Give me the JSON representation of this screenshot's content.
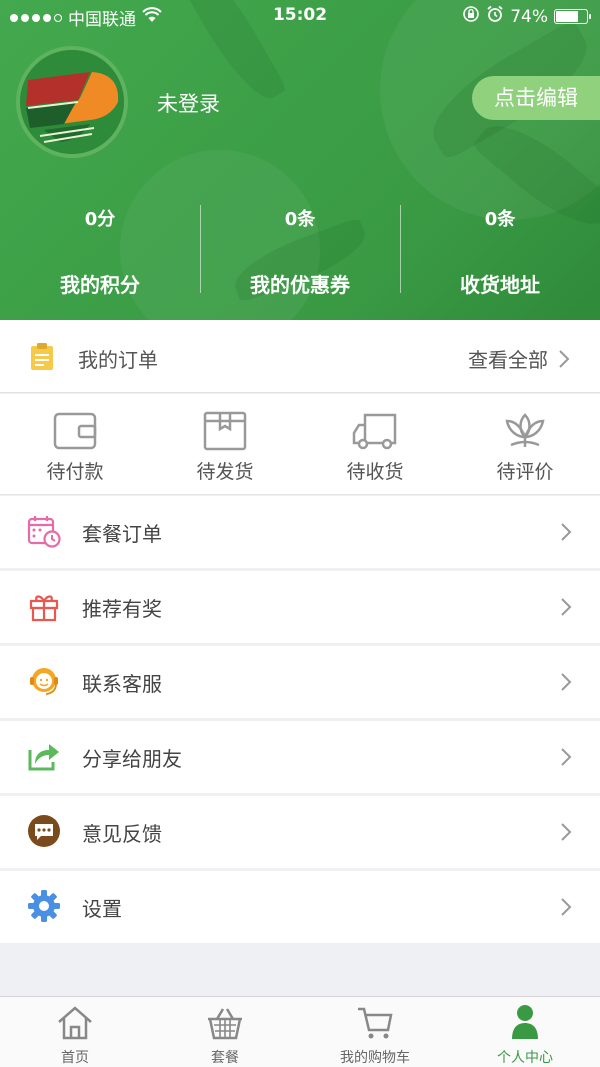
{
  "status_bar": {
    "carrier": "中国联通",
    "time": "15:02",
    "battery": "74%",
    "battery_level": 0.74
  },
  "profile": {
    "login_status": "未登录",
    "edit_label": "点击编辑"
  },
  "stats": [
    {
      "value": "0分",
      "label": "我的积分"
    },
    {
      "value": "0条",
      "label": "我的优惠券"
    },
    {
      "value": "0条",
      "label": "收货地址"
    }
  ],
  "orders": {
    "title": "我的订单",
    "view_all": "查看全部",
    "statuses": [
      {
        "label": "待付款",
        "icon": "wallet-icon"
      },
      {
        "label": "待发货",
        "icon": "package-icon"
      },
      {
        "label": "待收货",
        "icon": "truck-icon"
      },
      {
        "label": "待评价",
        "icon": "flower-icon"
      }
    ]
  },
  "menu": [
    {
      "label": "套餐订单",
      "icon": "calendar-clock-icon",
      "color": "#e86aa6"
    },
    {
      "label": "推荐有奖",
      "icon": "gift-icon",
      "color": "#e8584f"
    },
    {
      "label": "联系客服",
      "icon": "customer-service-icon",
      "color": "#f5a623"
    },
    {
      "label": "分享给朋友",
      "icon": "share-icon",
      "color": "#5cb85c"
    },
    {
      "label": "意见反馈",
      "icon": "feedback-icon",
      "color": "#7a4a1c"
    },
    {
      "label": "设置",
      "icon": "gear-icon",
      "color": "#4a90e2"
    }
  ],
  "tabbar": [
    {
      "label": "首页",
      "icon": "home-icon"
    },
    {
      "label": "套餐",
      "icon": "basket-icon"
    },
    {
      "label": "我的购物车",
      "icon": "cart-icon"
    },
    {
      "label": "个人中心",
      "icon": "person-icon",
      "active": true
    }
  ],
  "colors": {
    "brand_green": "#3a9a44",
    "edit_button": "#8fd17d",
    "order_icon": "#f7c948"
  }
}
